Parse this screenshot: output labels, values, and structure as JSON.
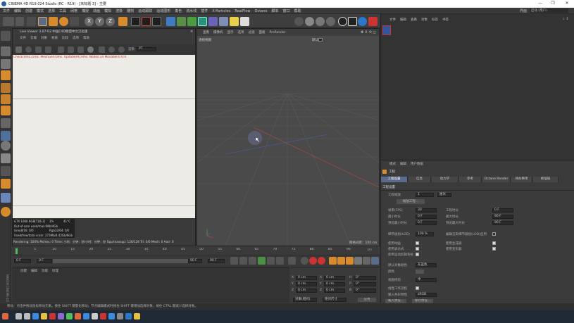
{
  "window": {
    "title": "CINEMA 4D R19.024 Studio (RC - R19) - [未标题 3] - 主要",
    "controls": [
      "—",
      "❐",
      "✕"
    ]
  },
  "menubar": {
    "items": [
      "文件",
      "编辑",
      "创建",
      "模式",
      "选择",
      "工具",
      "网格",
      "捕捉",
      "动画",
      "模拟",
      "渲染",
      "雕刻",
      "运动跟踪",
      "运动图形",
      "角色",
      "流水线",
      "插件",
      "X-Particles",
      "RealFlow",
      "Octane",
      "脚本",
      "窗口",
      "帮助"
    ],
    "layout_label": "界面",
    "layout_value": "启动 (用户)"
  },
  "live_viewer": {
    "title": "Live Viewer 3.07-R2 中国C4D联盟中文汉化版",
    "menu": [
      "文件",
      "云端",
      "对象",
      "材质",
      "比较",
      "选项",
      "帮助"
    ],
    "render_mode_label": "PT",
    "status": "Check:0ms./1ms. MeshGen:0ms. Update[M]:0ms. Nodes:34 Movable:0  0:0",
    "gpu_info": [
      {
        "name": "GTX 1060 6GB[T][6.1]",
        "load": "1%",
        "temp": "41°C"
      },
      {
        "name": "Out-of-core used/max:0Kb/4Gb",
        "load": "",
        "temp": ""
      },
      {
        "name": "Grey8/16: 0/0",
        "load": "Rgb32/64: 0/0",
        "temp": ""
      },
      {
        "name": "Used/free/total vram: 273Mb/4.42Gb/6Gb",
        "load": "",
        "temp": ""
      }
    ],
    "render_status": "Rendering: 100%   Ms/sec: 0   Time: 小时：分钟：秒/小时：分钟：秒   Spp/maxspp: 128/128   Tri: 0/0   Mesh: 0   Hair: 0"
  },
  "viewport": {
    "menu": [
      "查看",
      "摄像机",
      "显示",
      "选项",
      "过滤",
      "面板",
      "ProRender"
    ],
    "view_name": "透视视图",
    "grid_label": "网格间距：100 cm",
    "camera_label": "默认"
  },
  "timeline": {
    "ticks": [
      "0",
      "5",
      "10",
      "15",
      "20",
      "25",
      "30",
      "35",
      "40",
      "45",
      "50",
      "55",
      "60",
      "65",
      "70",
      "75",
      "80",
      "85",
      "90"
    ],
    "current_frame": "0 F",
    "start_frame": "0 F",
    "end_frame": "90 F",
    "end_frame2": "90 F",
    "frame_right": "0 F"
  },
  "object_manager": {
    "menu": [
      "文件",
      "编辑",
      "查看",
      "对象",
      "标签",
      "书签"
    ]
  },
  "material_manager": {
    "menu": [
      "创建",
      "编辑",
      "功能",
      "纹理"
    ]
  },
  "coordinates": {
    "rows": [
      {
        "a_label": "X",
        "a_val": "0 cm",
        "b_label": "X",
        "b_val": "0 cm",
        "c_label": "H",
        "c_val": "0°"
      },
      {
        "a_label": "Y",
        "a_val": "0 cm",
        "b_label": "Y",
        "b_val": "0 cm",
        "c_label": "P",
        "c_val": "0°"
      },
      {
        "a_label": "Z",
        "a_val": "0 cm",
        "b_label": "Z",
        "b_val": "0 cm",
        "c_label": "B",
        "c_val": "0°"
      }
    ],
    "mode1": "对象(相对)",
    "mode2": "绝对尺寸",
    "apply": "应用"
  },
  "right_panel": {
    "top_menu": [
      "文件",
      "编辑",
      "查看",
      "对象",
      "标签",
      "书签"
    ],
    "attr_menu": [
      "模式",
      "编辑",
      "用户数据"
    ],
    "project_label": "工程",
    "tabs": [
      "工程设置",
      "信息",
      "动力学",
      "参考",
      "Octane Render",
      "待办事项",
      "帧插值"
    ],
    "section": "工程设置",
    "scale_label": "工程缩放",
    "scale_value": "1",
    "scale_unit": "厘米",
    "scale_button": "缩放工程...",
    "params_left": [
      {
        "label": "帧率(FPS)",
        "value": "30"
      },
      {
        "label": "最小时长",
        "value": "0 F"
      },
      {
        "label": "预览最小时长",
        "value": "0 F"
      }
    ],
    "params_right": [
      {
        "label": "工程时长",
        "value": "0 F"
      },
      {
        "label": "最大时长",
        "value": "90 F"
      },
      {
        "label": "预览最大时长",
        "value": "90 F"
      }
    ],
    "lod_label": "细节级别(LOD)",
    "lod_value": "100 %",
    "lod_right": "编辑渲染细节级别(LOD)启用",
    "checks_left": [
      {
        "label": "使用动画",
        "on": true
      },
      {
        "label": "使用表达式",
        "on": true
      },
      {
        "label": "使用运动剪辑系统",
        "on": true
      }
    ],
    "checks_right": [
      {
        "label": "使用生成器",
        "on": true
      },
      {
        "label": "使用变形器",
        "on": true
      }
    ],
    "default_color_label": "默认对象颜色",
    "default_color_value": "灰蓝色",
    "color_label": "颜色",
    "view_clip_label": "视图修剪",
    "view_clip_value": "中",
    "linear_label": "线性工作流程",
    "input_color_label": "输入色彩特性",
    "input_color_value": "sRGB",
    "load_preset": "载入预设...",
    "save_preset": "保存预设..."
  },
  "status_bar": {
    "text": "移动：点击并拖动鼠标移动元素。按住 SHIFT 键量化移动；节点编辑模式时按住 SHIFT 键增加选择对象；按住 CTRL 键减少选择对象。"
  },
  "taskbar": {
    "icons": [
      "start-icon",
      "search-icon",
      "taskview-icon",
      "app-icon-1",
      "app-icon-2",
      "app-icon-3",
      "app-icon-4",
      "app-icon-5",
      "app-icon-6",
      "app-icon-7",
      "app-icon-8",
      "app-icon-9",
      "app-icon-10",
      "app-icon-11",
      "app-icon-12",
      "app-icon-13"
    ]
  },
  "colors": {
    "accent": "#5a6c8c",
    "viewport_bg": "#4a4a4a",
    "live_bg": "#ecebe6",
    "red_status": "#e63030"
  }
}
